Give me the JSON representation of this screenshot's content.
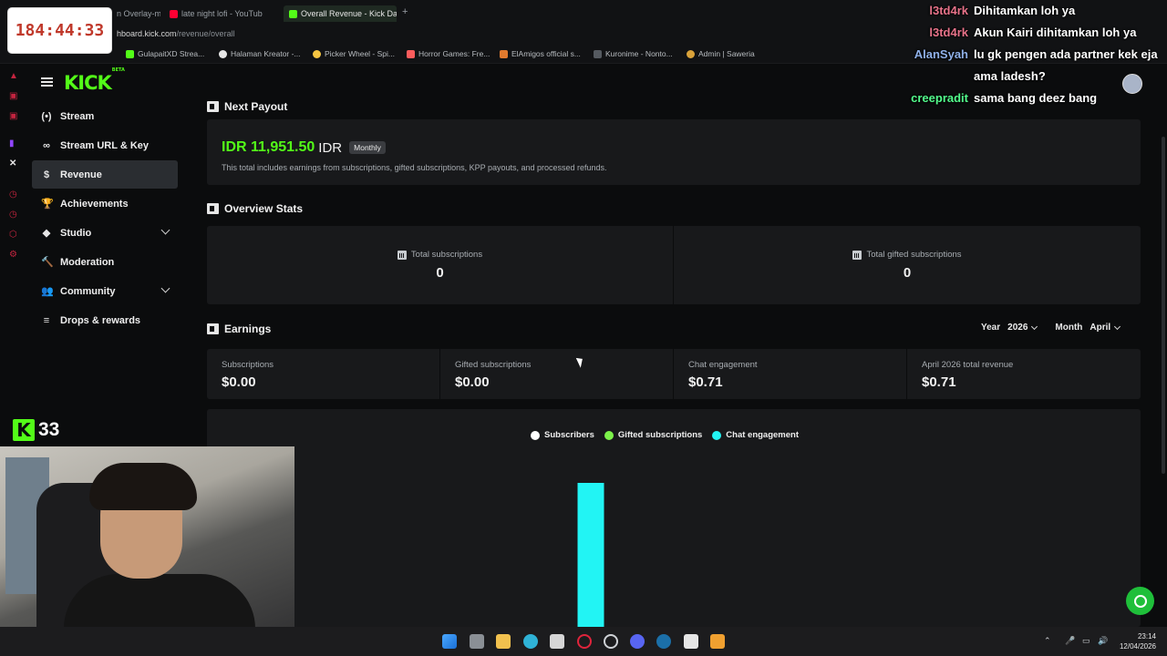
{
  "timer": "184:44:33",
  "browser": {
    "tabs": [
      {
        "label": "n Overlay-m",
        "color": "#9aa0a6",
        "active": false
      },
      {
        "label": "late night lofi - YouTub",
        "color": "#ff0033",
        "active": false
      },
      {
        "label": "Overall Revenue - Kick Da",
        "color": "#53fc18",
        "active": true
      }
    ],
    "new_tab": "+",
    "url_host": "hboard.kick.com",
    "url_path": "/revenue/overall",
    "bookmarks": [
      {
        "label": "GulapaitXD Strea...",
        "color": "#53fc18"
      },
      {
        "label": "Halaman Kreator -...",
        "color": "#e6e6e6"
      },
      {
        "label": "Picker Wheel - Spi...",
        "color": "#f5c542"
      },
      {
        "label": "Horror Games: Fre...",
        "color": "#fa5c5c"
      },
      {
        "label": "ElAmigos official s...",
        "color": "#e07a2e"
      },
      {
        "label": "Kuronime - Nonto...",
        "color": "#555a60"
      },
      {
        "label": "Admin | Saweria",
        "color": "#d9a23a"
      }
    ]
  },
  "sidebar": {
    "logo": "KICK",
    "logo_badge": "BETA",
    "items": [
      {
        "label": "Stream",
        "icon": "(•)",
        "active": false,
        "expandable": false
      },
      {
        "label": "Stream URL & Key",
        "icon": "∞",
        "active": false,
        "expandable": false
      },
      {
        "label": "Revenue",
        "icon": "$",
        "active": true,
        "expandable": false
      },
      {
        "label": "Achievements",
        "icon": "🏆",
        "active": false,
        "expandable": false
      },
      {
        "label": "Studio",
        "icon": "◆",
        "active": false,
        "expandable": true
      },
      {
        "label": "Moderation",
        "icon": "🔨",
        "active": false,
        "expandable": false
      },
      {
        "label": "Community",
        "icon": "👥",
        "active": false,
        "expandable": true
      },
      {
        "label": "Drops & rewards",
        "icon": "≡",
        "active": false,
        "expandable": false
      }
    ]
  },
  "payout": {
    "title": "Next Payout",
    "amount": "IDR 11,951.50",
    "currency": "IDR",
    "badge": "Monthly",
    "note": "This total includes earnings from subscriptions, gifted subscriptions, KPP payouts, and processed refunds."
  },
  "overview": {
    "title": "Overview Stats",
    "stats": [
      {
        "label": "Total subscriptions",
        "value": "0"
      },
      {
        "label": "Total gifted subscriptions",
        "value": "0"
      }
    ]
  },
  "earnings": {
    "title": "Earnings",
    "year_label": "Year",
    "year_value": "2026",
    "month_label": "Month",
    "month_value": "April",
    "cells": [
      {
        "label": "Subscriptions",
        "value": "$0.00"
      },
      {
        "label": "Gifted subscriptions",
        "value": "$0.00"
      },
      {
        "label": "Chat engagement",
        "value": "$0.71"
      },
      {
        "label": "April 2026 total revenue",
        "value": "$0.71"
      }
    ]
  },
  "chart_data": {
    "type": "bar",
    "series": [
      {
        "name": "Subscribers",
        "color": "#ffffff",
        "values": [
          0
        ]
      },
      {
        "name": "Gifted subscriptions",
        "color": "#7cf24a",
        "values": [
          0
        ]
      },
      {
        "name": "Chat engagement",
        "color": "#22f4f4",
        "values": [
          0.71
        ]
      }
    ],
    "categories": [
      ""
    ],
    "ylim": [
      0,
      0.71
    ]
  },
  "chat": [
    {
      "user": "l3td4rk",
      "color": "#e8738a",
      "msg": "Dihitamkan loh ya"
    },
    {
      "user": "l3td4rk",
      "color": "#e8738a",
      "msg": "Akun Kairi dihitamkan loh ya"
    },
    {
      "user": "AlanSyah",
      "color": "#8fb0e8",
      "msg": "lu gk pengen ada partner kek eja ama ladesh?"
    },
    {
      "user": "creepradit",
      "color": "#53fc8c",
      "msg": "sama bang deez bang"
    }
  ],
  "kick_overlay": {
    "icon": "K",
    "count": "33"
  },
  "taskbar": {
    "time": "23:14",
    "date": "12/04/2026"
  }
}
